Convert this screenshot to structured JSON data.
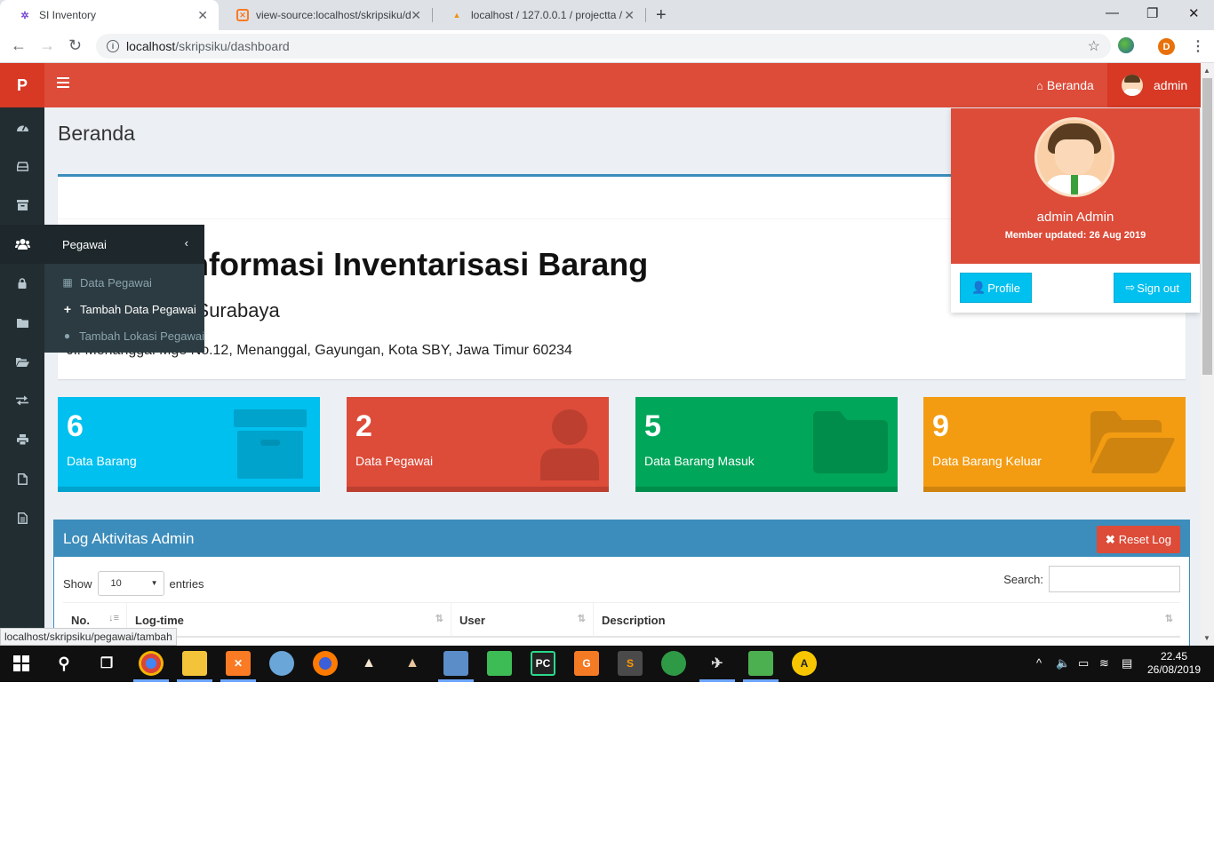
{
  "browser": {
    "tabs": [
      {
        "title": "SI Inventory",
        "favicon": "settings-gear-favicon"
      },
      {
        "title": "view-source:localhost/skripsiku/d",
        "favicon": "xampp-favicon"
      },
      {
        "title": "localhost / 127.0.0.1 / projectta /",
        "favicon": "phpmyadmin-favicon"
      }
    ],
    "url_host": "localhost",
    "url_path": "/skripsiku/dashboard",
    "profile_initial": "D",
    "status_url": "localhost/skripsiku/pegawai/tambah"
  },
  "app": {
    "logo": "P",
    "nav_beranda": "Beranda",
    "nav_user": "admin",
    "page_title": "Beranda",
    "hero_title": "Sistem Informasi Inventarisasi Barang",
    "hero_subtitle": "PT. ... Cabang Surabaya",
    "hero_address": "Jl. Menanggal Mge No.12, Menanggal, Gayungan, Kota SBY, Jawa Timur 60234",
    "sidebar_icons": [
      "dashboard-icon",
      "inbox-icon",
      "archive-icon",
      "users-icon",
      "lock-icon",
      "folder-icon",
      "folder-open-icon",
      "exchange-icon",
      "print-icon",
      "file-icon",
      "file-text-icon"
    ],
    "flyout": {
      "title": "Pegawai",
      "items": [
        {
          "label": "Data Pegawai",
          "icon": "table-icon"
        },
        {
          "label": "Tambah Data Pegawai",
          "icon": "plus-icon"
        },
        {
          "label": "Tambah Lokasi Pegawai",
          "icon": "map-pin-icon"
        }
      ]
    },
    "stats": [
      {
        "value": "6",
        "label": "Data Barang",
        "color": "#00c0ef",
        "icon": "archive-icon"
      },
      {
        "value": "2",
        "label": "Data Pegawai",
        "color": "#dd4b39",
        "icon": "user-icon"
      },
      {
        "value": "5",
        "label": "Data Barang Masuk",
        "color": "#00a65a",
        "icon": "folder-icon"
      },
      {
        "value": "9",
        "label": "Data Barang Keluar",
        "color": "#f39c12",
        "icon": "folder-open-icon"
      }
    ],
    "log": {
      "title": "Log Aktivitas Admin",
      "reset_label": "Reset Log",
      "show_label": "Show",
      "entries_value": "10",
      "entries_label": "entries",
      "search_label": "Search:",
      "columns": [
        "No.",
        "Log-time",
        "User",
        "Description"
      ]
    },
    "user_dropdown": {
      "name": "admin Admin",
      "meta": "Member updated: 26 Aug 2019",
      "profile_label": "Profile",
      "signout_label": "Sign out"
    }
  },
  "taskbar": {
    "time": "22.45",
    "date": "26/08/2019"
  }
}
